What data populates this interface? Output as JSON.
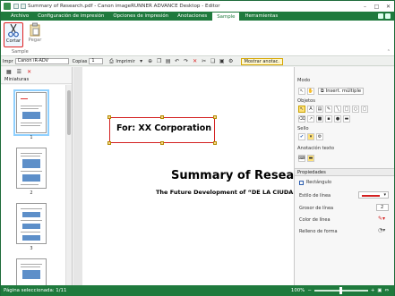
{
  "window": {
    "title": "Summary of Research.pdf - Canon imageRUNNER ADVANCE Desktop - Editor"
  },
  "ribbon_tabs": [
    {
      "label": "Archivo",
      "active": false
    },
    {
      "label": "Configuración de impresión",
      "active": false
    },
    {
      "label": "Opciones de impresión",
      "active": false
    },
    {
      "label": "Anotaciones",
      "active": false
    },
    {
      "label": "Sample",
      "active": true
    },
    {
      "label": "Herramientas",
      "active": false
    }
  ],
  "ribbon": {
    "cut_label": "Cortar",
    "paste_label": "Pegar",
    "group_label": "Sample"
  },
  "toolbar2": {
    "printer_label": "Impr",
    "printer_value": "Canon iR-ADV",
    "copies_label": "Copias",
    "copies_value": "1",
    "print_label": "Imprimir",
    "show_annotations_label": "Mostrar anotac."
  },
  "left_panel": {
    "header": "Miniaturas",
    "pages": [
      "1",
      "2",
      "3"
    ]
  },
  "document": {
    "note_text": "For: XX Corporation",
    "title": "Summary of Research",
    "subtitle": "The Future Development of “DE LA CIUDAD"
  },
  "right_panel": {
    "mode_label": "Modo",
    "multi_insert_label": "Insert. múltiple",
    "objects_label": "Objetos",
    "stamp_label": "Sello",
    "text_annotation_label": "Anotación texto",
    "properties_label": "Propiedades",
    "shape_name": "Rectángulo",
    "line_style_label": "Estilo de línea",
    "line_width_label": "Grosor de línea",
    "line_width_value": "2",
    "line_color_label": "Color de línea",
    "fill_label": "Relleno de forma"
  },
  "status": {
    "pages_selected": "Página seleccionada: 1/11",
    "zoom": "100%"
  },
  "colors": {
    "accent": "#1f7a3d",
    "highlight": "#d32020"
  }
}
